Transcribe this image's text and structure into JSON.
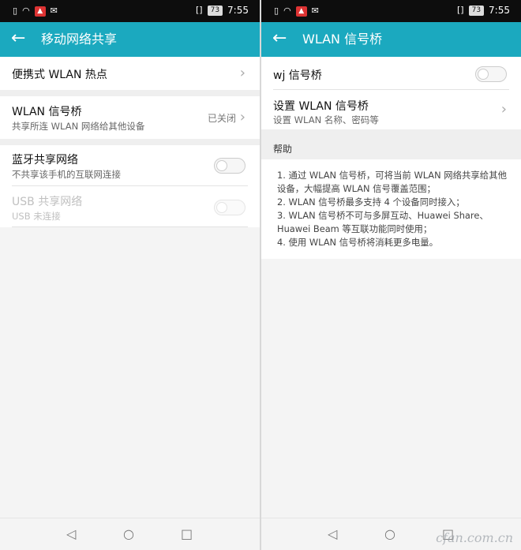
{
  "status_bar": {
    "left_icons": [
      "phone-icon",
      "wifi-icon",
      "alert-icon",
      "message-icon"
    ],
    "vibrate": "[]",
    "battery": "73",
    "time": "7:55"
  },
  "left": {
    "title": "移动网络共享",
    "items": [
      {
        "title": "便携式 WLAN 热点"
      },
      {
        "title": "WLAN 信号桥",
        "subtitle": "共享所连 WLAN 网络给其他设备",
        "status": "已关闭"
      },
      {
        "title": "蓝牙共享网络",
        "subtitle": "不共享该手机的互联网连接",
        "toggle": "off"
      },
      {
        "title": "USB 共享网络",
        "subtitle": "USB 未连接",
        "toggle": "off",
        "disabled": true
      }
    ]
  },
  "right": {
    "title": "WLAN 信号桥",
    "items": [
      {
        "title": "wj 信号桥",
        "toggle": "off"
      },
      {
        "title": "设置 WLAN 信号桥",
        "subtitle": "设置 WLAN 名称、密码等"
      }
    ],
    "help_header": "帮助",
    "help_lines": [
      "1. 通过 WLAN 信号桥，可将当前 WLAN 网络共享给其他设备，大幅提高 WLAN 信号覆盖范围；",
      "2. WLAN 信号桥最多支持 4 个设备同时接入；",
      "3. WLAN 信号桥不可与多屏互动、Huawei Share、Huawei Beam 等互联功能同时使用；",
      "4. 使用 WLAN 信号桥将消耗更多电量。"
    ]
  },
  "nav": {
    "back": "◁",
    "home": "○",
    "recent": "□"
  },
  "watermark": "cfan.com.cn",
  "colors": {
    "accent": "#1ba9bf",
    "status_bar": "#0d0d0d",
    "background": "#f4f4f4"
  }
}
